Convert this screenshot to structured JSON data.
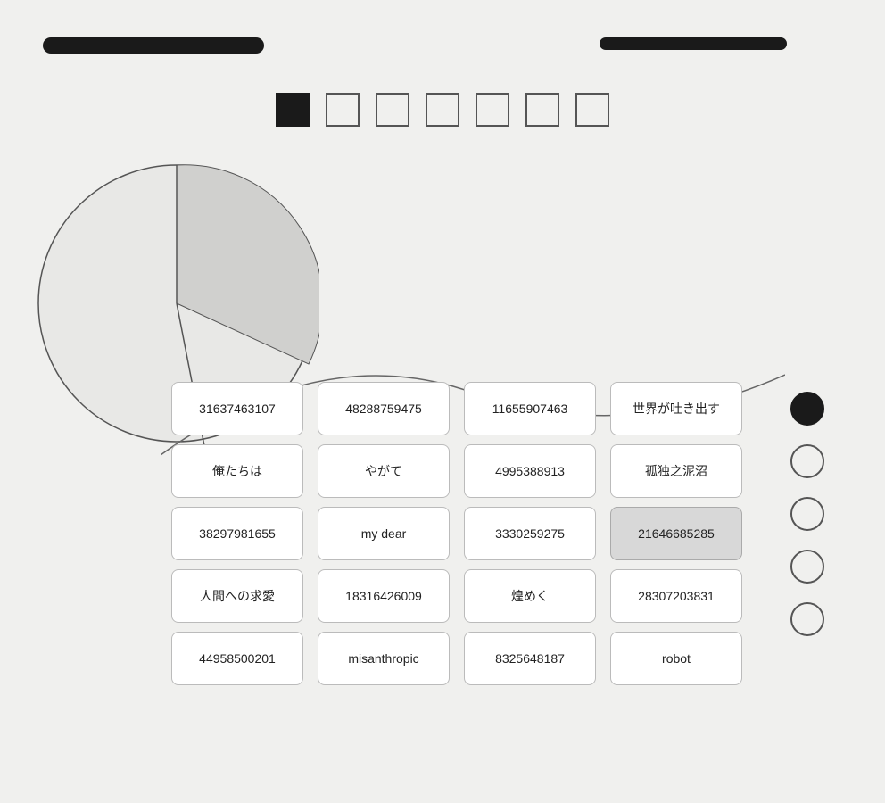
{
  "topBar": {
    "leftLabel": "top-bar-left",
    "rightLabel": "top-bar-right"
  },
  "squares": [
    {
      "id": "sq1",
      "filled": true
    },
    {
      "id": "sq2",
      "filled": false
    },
    {
      "id": "sq3",
      "filled": false
    },
    {
      "id": "sq4",
      "filled": false
    },
    {
      "id": "sq5",
      "filled": false
    },
    {
      "id": "sq6",
      "filled": false
    },
    {
      "id": "sq7",
      "filled": false
    }
  ],
  "grid": {
    "rows": [
      [
        "31637463107",
        "48288759475",
        "11655907463",
        "世界が吐き出す"
      ],
      [
        "俺たちは",
        "やがて",
        "4995388913",
        "孤独之泥沼"
      ],
      [
        "38297981655",
        "my dear",
        "3330259275",
        "21646685285"
      ],
      [
        "人間への求愛",
        "18316426009",
        "煌めく",
        "28307203831"
      ],
      [
        "44958500201",
        "misanthropic",
        "8325648187",
        "robot"
      ]
    ]
  },
  "circles": [
    {
      "filled": true
    },
    {
      "filled": false
    },
    {
      "filled": false
    },
    {
      "filled": false
    },
    {
      "filled": false
    }
  ]
}
